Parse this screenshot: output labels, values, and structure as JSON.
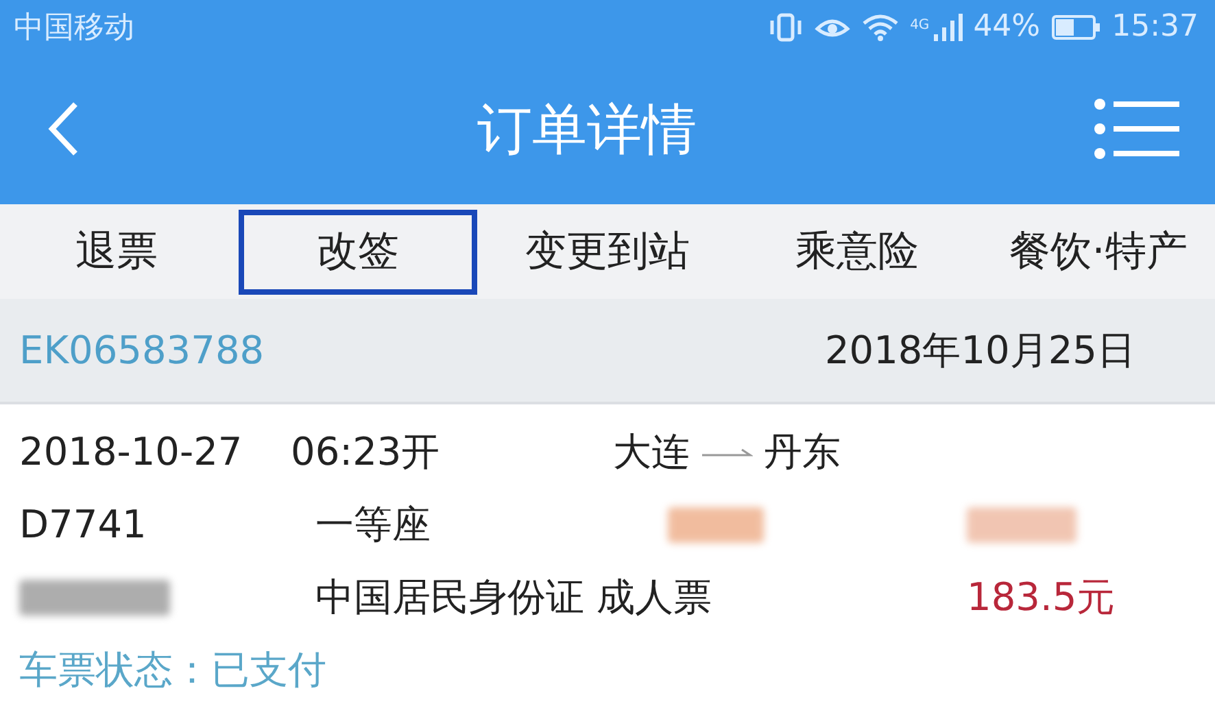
{
  "status_bar": {
    "carrier": "中国移动",
    "network": "4G",
    "battery": "44%",
    "time": "15:37"
  },
  "header": {
    "title": "订单详情"
  },
  "tabs": [
    {
      "label": "退票",
      "selected": false
    },
    {
      "label": "改签",
      "selected": true
    },
    {
      "label": "变更到站",
      "selected": false
    },
    {
      "label": "乘意险",
      "selected": false
    },
    {
      "label": "餐饮·特产",
      "selected": false
    }
  ],
  "order": {
    "number": "EK06583788",
    "date": "2018年10月25日"
  },
  "ticket": {
    "date": "2018-10-27",
    "departure": "06:23开",
    "from": "大连",
    "to": "丹东",
    "train": "D7741",
    "seat_class": "一等座",
    "id_type": "中国居民身份证",
    "ticket_type": "成人票",
    "price": "183.5元",
    "status_label": "车票状态：",
    "status": "已支付"
  }
}
